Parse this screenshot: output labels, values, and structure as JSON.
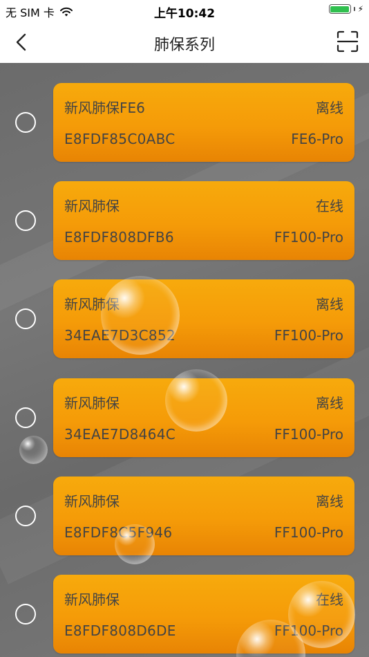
{
  "status_bar": {
    "carrier": "无 SIM 卡",
    "time": "上午10:42",
    "battery_color": "#30c04f"
  },
  "nav": {
    "title": "肺保系列",
    "back_icon": "chevron-left-icon",
    "scan_icon": "scan-icon"
  },
  "devices": [
    {
      "name": "新风肺保FE6",
      "status": "离线",
      "mac": "E8FDF85C0ABC",
      "model": "FE6-Pro",
      "selected": false
    },
    {
      "name": "新风肺保",
      "status": "在线",
      "mac": "E8FDF808DFB6",
      "model": "FF100-Pro",
      "selected": false
    },
    {
      "name": "新风肺保",
      "status": "离线",
      "mac": "34EAE7D3C852",
      "model": "FF100-Pro",
      "selected": false
    },
    {
      "name": "新风肺保",
      "status": "离线",
      "mac": "34EAE7D8464C",
      "model": "FF100-Pro",
      "selected": false
    },
    {
      "name": "新风肺保",
      "status": "离线",
      "mac": "E8FDF8C5F946",
      "model": "FF100-Pro",
      "selected": false
    },
    {
      "name": "新风肺保",
      "status": "在线",
      "mac": "E8FDF808D6DE",
      "model": "FF100-Pro",
      "selected": false
    }
  ],
  "colors": {
    "card_top": "#f7aa0c",
    "card_bottom": "#e88404",
    "background": "#707070",
    "text": "#444444"
  }
}
